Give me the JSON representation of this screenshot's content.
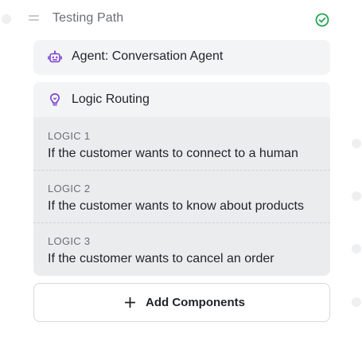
{
  "node": {
    "title": "Testing Path",
    "status": "complete"
  },
  "agent": {
    "label": "Agent: Conversation Agent"
  },
  "logic_routing": {
    "label": "Logic Routing",
    "items": [
      {
        "tag": "LOGIC 1",
        "description": "If the customer wants to connect to a human"
      },
      {
        "tag": "LOGIC 2",
        "description": "If the customer wants to know about products"
      },
      {
        "tag": "LOGIC 3",
        "description": "If the customer wants to cancel an order"
      }
    ]
  },
  "add_components": {
    "label": "Add Components"
  },
  "colors": {
    "accent_purple": "#7b3fd1",
    "success_green": "#22a654"
  }
}
